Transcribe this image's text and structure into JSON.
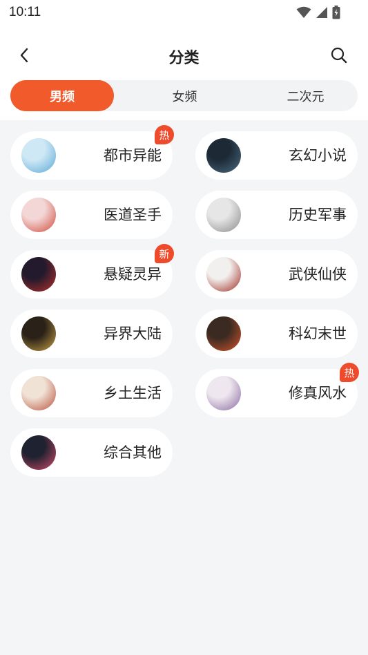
{
  "status_bar": {
    "time": "10:11"
  },
  "header": {
    "title": "分类",
    "back_icon": "chevron-left-icon",
    "search_icon": "search-icon"
  },
  "tabs": [
    {
      "label": "男频",
      "active": true
    },
    {
      "label": "女频",
      "active": false
    },
    {
      "label": "二次元",
      "active": false
    }
  ],
  "colors": {
    "accent": "#f15a2b",
    "badge": "#ee4a2c",
    "background": "#f4f5f7"
  },
  "categories": [
    {
      "label": "都市异能",
      "badge": "热",
      "cover_colors": [
        "#cfe8f5",
        "#5aa9d6"
      ]
    },
    {
      "label": "玄幻小说",
      "badge": "",
      "cover_colors": [
        "#1d2a36",
        "#4b6b80"
      ]
    },
    {
      "label": "医道圣手",
      "badge": "",
      "cover_colors": [
        "#f3d6d6",
        "#d04a3a"
      ]
    },
    {
      "label": "历史军事",
      "badge": "",
      "cover_colors": [
        "#e6e6e6",
        "#8a8a8a"
      ]
    },
    {
      "label": "悬疑灵异",
      "badge": "新",
      "cover_colors": [
        "#231a2d",
        "#b8302a"
      ]
    },
    {
      "label": "武侠仙侠",
      "badge": "",
      "cover_colors": [
        "#f2f0ee",
        "#a02a22"
      ]
    },
    {
      "label": "异界大陆",
      "badge": "",
      "cover_colors": [
        "#2a2218",
        "#c9a246"
      ]
    },
    {
      "label": "科幻末世",
      "badge": "",
      "cover_colors": [
        "#3b2a22",
        "#d4552a"
      ]
    },
    {
      "label": "乡土生活",
      "badge": "",
      "cover_colors": [
        "#f1e2d6",
        "#b8523c"
      ]
    },
    {
      "label": "修真风水",
      "badge": "热",
      "cover_colors": [
        "#efe7ef",
        "#8a6aa0"
      ]
    },
    {
      "label": "综合其他",
      "badge": "",
      "cover_colors": [
        "#1f2230",
        "#d44a6a"
      ]
    }
  ]
}
